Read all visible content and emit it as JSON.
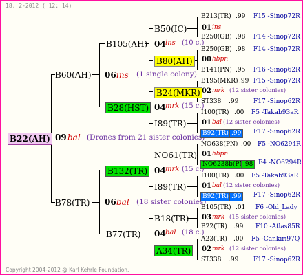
{
  "header": "18.   2-2012 ( 12: 14)",
  "footer": "Copyright 2004-2012 @ Karl Kehrle Foundation.",
  "root": {
    "name": "B22(AH)",
    "gen": "09",
    "race": "bal",
    "note": "(Drones from 21 sister colonies)"
  },
  "g1": [
    {
      "name": "B60(AH)",
      "gen": "06",
      "race": "ins",
      "note": "(1 single colony)"
    },
    {
      "name": "B78(TR)",
      "gen": "06",
      "race": "bal",
      "note": "(18 sister colonies)"
    }
  ],
  "g2": [
    {
      "name": "B105(AH)",
      "gen": "04",
      "race": "ins",
      "note": "(10 c.)"
    },
    {
      "name": "B28(HST)",
      "gen": "04",
      "race": "mrk",
      "note": "(15 c.)"
    },
    {
      "name": "B132(TR)",
      "gen": "04",
      "race": "mrk",
      "note": "(15 c.)"
    },
    {
      "name": "B77(TR)",
      "gen": "04",
      "race": "bal",
      "note": "(18 c.)"
    }
  ],
  "g3": [
    {
      "name": "B50(IC)",
      "gen": "01",
      "race": "ins",
      "note": ""
    },
    {
      "name": "B80(AH)",
      "gen": "00",
      "race": "hbpn",
      "note": ""
    },
    {
      "name": "B24(MKR)",
      "gen": "02",
      "race": "mrk",
      "note": "(12 sister colonies)"
    },
    {
      "name": "I89(TR)",
      "gen": "01",
      "race": "bal",
      "note": "(12 sister colonies)"
    },
    {
      "name": "NO61(TR)",
      "gen": "01",
      "race": "hbpn",
      "note": ""
    },
    {
      "name": "I89(TR)",
      "gen": "01",
      "race": "bal",
      "note": "(12 sister colonies)"
    },
    {
      "name": "B18(TR)",
      "gen": "03",
      "race": "mrk",
      "note": "(15 sister colonies)"
    },
    {
      "name": "A34(TR)",
      "gen": "02",
      "race": "mrk",
      "note": "(12 sister colonies)"
    }
  ],
  "g4": [
    {
      "name": "B213(TR)",
      "val": ".99",
      "code": "F15 -Sinop72R"
    },
    {
      "name": "B250(GB)",
      "val": ".98",
      "code": "F14 -Sinop72R"
    },
    {
      "name": "B250(GB)",
      "val": ".98",
      "code": "F14 -Sinop72R"
    },
    {
      "name": "B141(PN)",
      "val": ".95",
      "code": "F16 -Sinop62R"
    },
    {
      "name": "B195(MKR)",
      "val": ".99",
      "code": "F15 -Sinop72R"
    },
    {
      "name": "ST338",
      "val": ".99",
      "code": "F17 -Sinop62R"
    },
    {
      "name": "I100(TR)",
      "val": ".00",
      "code": "F5 -Takab93aR"
    },
    {
      "name": "B92(TR)",
      "val": ".99",
      "code": "F17 -Sinop62R"
    },
    {
      "name": "NO638(PN)",
      "val": ".00",
      "code": "F5 -NO6294R"
    },
    {
      "name": "NO6238b(PN)",
      "val": ".98",
      "code": "F4 -NO6294R"
    },
    {
      "name": "I100(TR)",
      "val": ".00",
      "code": "F5 -Takab93aR"
    },
    {
      "name": "B92(TR)",
      "val": ".99",
      "code": "F17 -Sinop62R"
    },
    {
      "name": "B105(TR)",
      "val": ".01",
      "code": "F6 -Old_Lady"
    },
    {
      "name": "B22(TR)",
      "val": ".99",
      "code": "F10 -Atlas85R"
    },
    {
      "name": "A23(TR)",
      "val": ".00",
      "code": "F5 -Cankiri97Q"
    },
    {
      "name": "ST338",
      "val": ".99",
      "code": "F17 -Sinop62R"
    }
  ]
}
